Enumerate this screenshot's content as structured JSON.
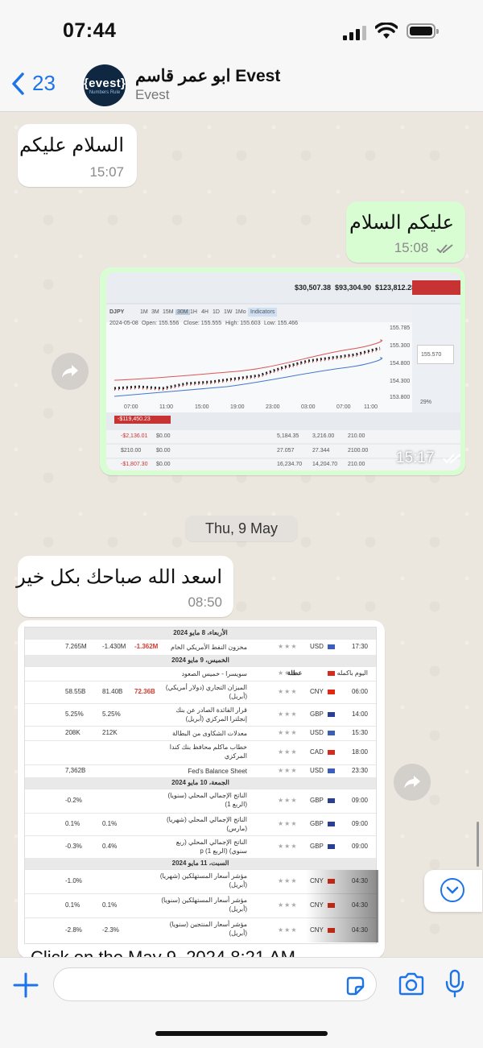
{
  "status_bar": {
    "time": "07:44"
  },
  "header": {
    "back_count": "23",
    "avatar_text": "{evest}",
    "avatar_sub": "Numbers Rule",
    "contact_name": "ابو عمر قاسم Evest",
    "contact_sub": "Evest"
  },
  "messages": [
    {
      "text": "السلام عليكم",
      "time": "15:07"
    },
    {
      "text": "عليكم السلام",
      "time": "15:08"
    },
    {
      "text": "",
      "time": "15:17"
    },
    {
      "text": "اسعد الله صباحك بكل خير",
      "time": "08:50"
    }
  ],
  "date_separator": "Thu, 9 May",
  "photo": {
    "balances": [
      "$30,507.38",
      "$93,304.90",
      "$123,812.28"
    ],
    "timeframes": [
      "1M",
      "3M",
      "15M",
      "30M",
      "1H",
      "4H",
      "1D",
      "1W",
      "1Mo"
    ],
    "indicators_label": "Indicators",
    "symbol": "DJPY",
    "date": "2024-05-08",
    "open": "Open: 155.556",
    "close": "Close: 155.555",
    "high": "High: 155.603",
    "low": "Low: 155.466",
    "price_ticks": [
      "155.785",
      "155.300",
      "154.800",
      "154.300",
      "153.800"
    ],
    "time_ticks": [
      "07:00",
      "11:00",
      "15:00",
      "19:00",
      "23:00",
      "03:00",
      "07:00",
      "11:00"
    ],
    "pnl": "-$119,450.23",
    "side_value": "155.570",
    "percent": "29%",
    "table_rows": [
      [
        "-$2,136.01",
        "$0.00",
        "5,184.35",
        "3,216.00",
        "210.00"
      ],
      [
        "$210.00",
        "$0.00",
        "27.057",
        "27.344",
        "2100.00"
      ],
      [
        "-$1,807.30",
        "$0.00",
        "16,234.70",
        "14,204.70",
        "210.00"
      ]
    ]
  },
  "calendar": {
    "days": [
      "الأربعاء، 8 مايو 2024",
      "الخميس، 9 مايو 2024",
      "الجمعة، 10 مايو 2024",
      "السبت، 11 مايو 2024"
    ],
    "rows": [
      {
        "time": "17:30",
        "cur": "USD",
        "flag": "us",
        "event": "مخزون النفط الأمريكي الخام",
        "actual": "-1.362M",
        "forecast": "-1.430M",
        "prev": "7.265M"
      },
      {
        "time": "اليوم باكمله",
        "cur": "",
        "flag": "ch",
        "event": "سويسرا - خميس الصعود",
        "actual": "",
        "forecast": "",
        "prev": "",
        "holiday": "عطلة"
      },
      {
        "time": "06:00",
        "cur": "CNY",
        "flag": "cn",
        "event": "الميزان التجاري (دولار أمريكي) (أبريل)",
        "actual": "72.36B",
        "forecast": "81.40B",
        "prev": "58.55B"
      },
      {
        "time": "14:00",
        "cur": "GBP",
        "flag": "gb",
        "event": "قرار الفائدة الصادر عن بنك إنجلترا المركزي (أبريل)",
        "actual": "",
        "forecast": "5.25%",
        "prev": "5.25%"
      },
      {
        "time": "15:30",
        "cur": "USD",
        "flag": "us",
        "event": "معدلات الشكاوى من البطالة",
        "actual": "",
        "forecast": "212K",
        "prev": "208K"
      },
      {
        "time": "18:00",
        "cur": "CAD",
        "flag": "ca",
        "event": "خطاب ماكلم محافظ بنك كندا المركزي",
        "actual": "",
        "forecast": "",
        "prev": ""
      },
      {
        "time": "23:30",
        "cur": "USD",
        "flag": "us",
        "event": "Fed's Balance Sheet",
        "actual": "",
        "forecast": "",
        "prev": "7,362B"
      },
      {
        "time": "09:00",
        "cur": "GBP",
        "flag": "gb",
        "event": "الناتج الإجمالي المحلي (سنويا) (الربع 1)",
        "actual": "",
        "forecast": "",
        "prev": "-0.2%"
      },
      {
        "time": "09:00",
        "cur": "GBP",
        "flag": "gb",
        "event": "الناتج الإجمالي المحلي (شهريا) (مارس)",
        "actual": "",
        "forecast": "0.1%",
        "prev": "0.1%"
      },
      {
        "time": "09:00",
        "cur": "GBP",
        "flag": "gb",
        "event": "الناتج الإجمالي المحلي (ربع سنوي) (الربع 1) p",
        "actual": "",
        "forecast": "0.4%",
        "prev": "-0.3%"
      },
      {
        "time": "04:30",
        "cur": "CNY",
        "flag": "cn",
        "event": "مؤشر أسعار المستهلكين (شهريا) (أبريل)",
        "actual": "",
        "forecast": "",
        "prev": "-1.0%"
      },
      {
        "time": "04:30",
        "cur": "CNY",
        "flag": "cn",
        "event": "مؤشر أسعار المستهلكين (سنويا) (أبريل)",
        "actual": "",
        "forecast": "0.1%",
        "prev": "0.1%"
      },
      {
        "time": "04:30",
        "cur": "CNY",
        "flag": "cn",
        "event": "مؤشر أسعار المنتجين (سنويا) (أبريل)",
        "actual": "",
        "forecast": "-2.3%",
        "prev": "-2.8%"
      }
    ]
  },
  "cut_text": "Click on the May 9, 2024 8:21 AM",
  "colors": {
    "accent": "#1d73e8",
    "outgoing": "#d9fdd3",
    "incoming": "#ffffff",
    "read_ticks": "#8a8a8a"
  }
}
